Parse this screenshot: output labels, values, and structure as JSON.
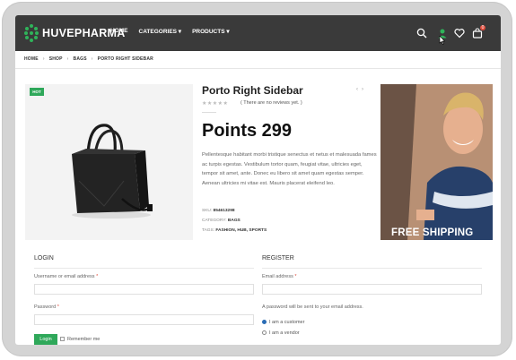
{
  "header": {
    "logo_text": "HUVEPHARMA",
    "nav": [
      "HOME",
      "CATEGORIES ▾",
      "PRODUCTS ▾"
    ],
    "cart_count": "0"
  },
  "breadcrumb": [
    "HOME",
    "SHOP",
    "BAGS",
    "PORTO RIGHT SIDEBAR"
  ],
  "product": {
    "badge": "HOT",
    "title": "Porto Right Sidebar",
    "stars": "★★★★★",
    "reviews": "( There are no reviews yet. )",
    "price": "Points 299",
    "description": "Pellentesque habitant morbi tristique senectus et netus et malesuada fames ac turpis egestas. Vestibulum tortor quam, feugiat vitae, ultricies eget, tempor sit amet, ante. Donec eu libero sit amet quam egestas semper. Aenean ultricies mi vitae est. Mauris placerat eleifend leo.",
    "sku_label": "SKU:",
    "sku_value": "854613298",
    "category_label": "CATEGORY:",
    "category_value": "BAGS",
    "tags_label": "TAGS:",
    "tags_value": "FASHION, HUB, SPORTS"
  },
  "banner": {
    "text": "FREE SHIPPING"
  },
  "login": {
    "title": "LOGIN",
    "username_label": "Username or email address",
    "password_label": "Password",
    "button": "Login",
    "remember": "Remember me"
  },
  "register": {
    "title": "REGISTER",
    "email_label": "Email address",
    "note": "A password will be sent to your email address.",
    "opt_customer": "I am a customer",
    "opt_vendor": "I am a vendor"
  },
  "colors": {
    "header_bg": "#3a3a3a",
    "accent_green": "#2fa85a",
    "badge_red": "#e04b3b"
  }
}
